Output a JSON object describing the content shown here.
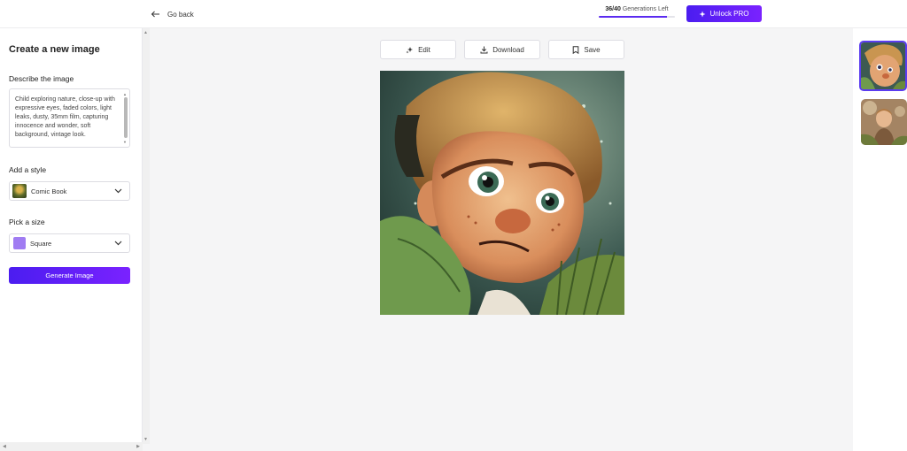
{
  "header": {
    "back_label": "Go back",
    "generations_used": "36/40",
    "generations_suffix": "Generations Left",
    "generations_fraction": 0.9,
    "unlock_label": "Unlock PRO"
  },
  "sidebar": {
    "title": "Create a new image",
    "describe_label": "Describe the image",
    "description": "Child exploring nature, close-up with expressive eyes, faded colors, light leaks, dusty, 35mm film, capturing innocence and wonder, soft background, vintage look.",
    "style_label": "Add a style",
    "style_value": "Comic Book",
    "size_label": "Pick a size",
    "size_value": "Square",
    "generate_label": "Generate Image"
  },
  "toolbar": {
    "edit_label": "Edit",
    "download_label": "Download",
    "save_label": "Save"
  },
  "colors": {
    "accent": "#5b2bf0",
    "accent_gradient_end": "#7a22ff",
    "size_swatch": "#a07cf2"
  }
}
